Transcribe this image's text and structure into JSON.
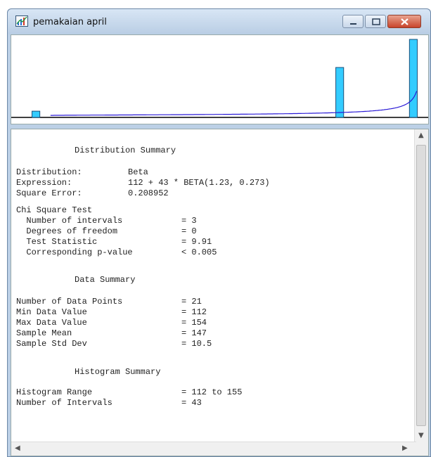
{
  "window": {
    "title": "pemakaian april",
    "colors": {
      "bar_fill": "#33ccff",
      "bar_stroke": "#1a4f7a",
      "curve": "#2a1ad6",
      "axis": "#000000"
    }
  },
  "chart_data": {
    "type": "bar",
    "title": "",
    "xlabel": "",
    "ylabel": "",
    "x_range": [
      112,
      155
    ],
    "bars": [
      {
        "x": 113,
        "height": 0.08
      },
      {
        "x": 146,
        "height": 0.64
      },
      {
        "x": 154,
        "height": 1.0
      }
    ],
    "fitted_curve": {
      "name": "",
      "shape": "beta",
      "note": "Beta density fit"
    }
  },
  "summary": {
    "heading_distribution": "Distribution Summary",
    "distribution_label": "Distribution:",
    "distribution_value": "Beta",
    "expression_label": "Expression:",
    "expression_value": "112 + 43 * BETA(1.23, 0.273)",
    "square_error_label": "Square Error:",
    "square_error_value": "0.208952",
    "chi_heading": "Chi Square Test",
    "chi_rows": [
      {
        "label": "  Number of intervals",
        "value": "= 3"
      },
      {
        "label": "  Degrees of freedom",
        "value": "= 0"
      },
      {
        "label": "  Test Statistic",
        "value": "= 9.91"
      },
      {
        "label": "  Corresponding p-value",
        "value": "< 0.005"
      }
    ],
    "heading_data": "Data Summary",
    "data_rows": [
      {
        "label": "Number of Data Points",
        "value": "= 21"
      },
      {
        "label": "Min Data Value",
        "value": "= 112"
      },
      {
        "label": "Max Data Value",
        "value": "= 154"
      },
      {
        "label": "Sample Mean",
        "value": "= 147"
      },
      {
        "label": "Sample Std Dev",
        "value": "= 10.5"
      }
    ],
    "heading_histogram": "Histogram Summary",
    "hist_rows": [
      {
        "label": "Histogram Range",
        "value": "= 112 to 155"
      },
      {
        "label": "Number of Intervals",
        "value": "= 43"
      }
    ]
  }
}
